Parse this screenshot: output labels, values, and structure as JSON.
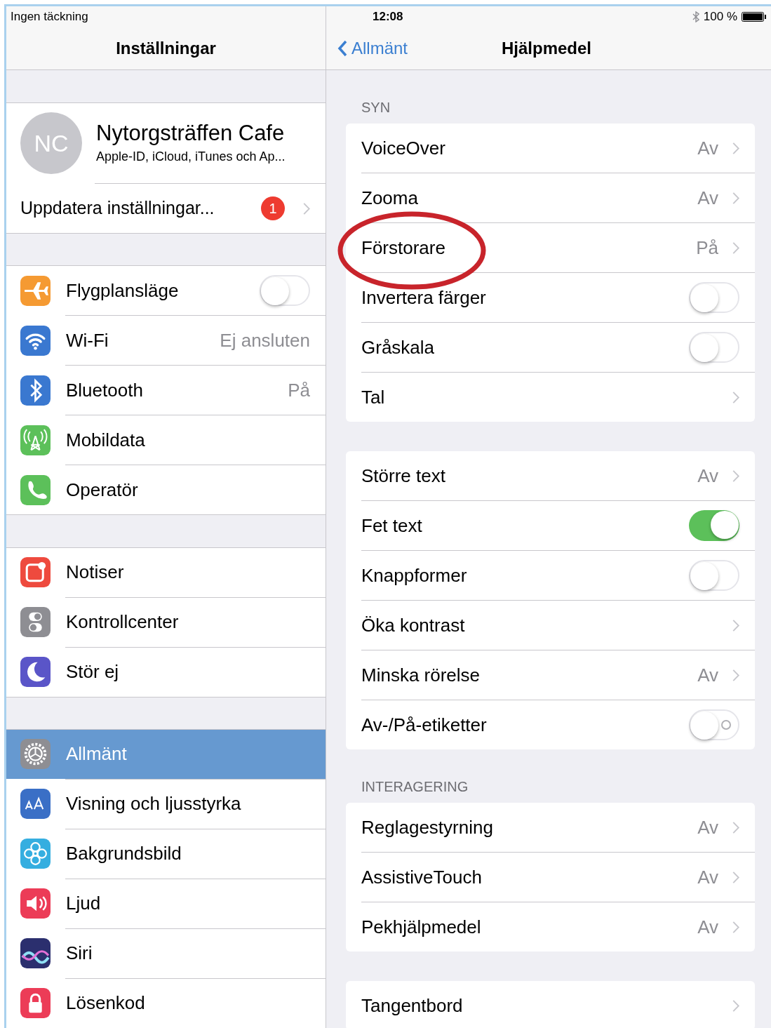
{
  "status_bar": {
    "carrier": "Ingen täckning",
    "time": "12:08",
    "battery": "100 %"
  },
  "sidebar": {
    "title": "Inställningar",
    "profile": {
      "initials": "NC",
      "name": "Nytorgsträffen Cafe",
      "subtitle": "Apple-ID, iCloud, iTunes och Ap..."
    },
    "update": {
      "label": "Uppdatera inställningar...",
      "badge": "1"
    },
    "groups": [
      [
        {
          "label": "Flygplansläge",
          "kind": "toggle",
          "on": false,
          "color": "#f59a32",
          "selected": false
        },
        {
          "label": "Wi-Fi",
          "kind": "value",
          "value": "Ej ansluten",
          "color": "#3a78d0",
          "selected": false
        },
        {
          "label": "Bluetooth",
          "kind": "value",
          "value": "På",
          "color": "#3a78d0",
          "selected": false
        },
        {
          "label": "Mobildata",
          "kind": "plain",
          "color": "#5cc05a",
          "selected": false
        },
        {
          "label": "Operatör",
          "kind": "plain",
          "color": "#5cc05a",
          "selected": false
        }
      ],
      [
        {
          "label": "Notiser",
          "kind": "plain",
          "color": "#ee4a3e",
          "selected": false
        },
        {
          "label": "Kontrollcenter",
          "kind": "plain",
          "color": "#8e8e93",
          "selected": false
        },
        {
          "label": "Stör ej",
          "kind": "plain",
          "color": "#5a55c8",
          "selected": false
        }
      ],
      [
        {
          "label": "Allmänt",
          "kind": "plain",
          "color": "#8e8e93",
          "selected": true
        },
        {
          "label": "Visning och ljusstyrka",
          "kind": "plain",
          "color": "#3a6fc6",
          "selected": false
        },
        {
          "label": "Bakgrundsbild",
          "kind": "plain",
          "color": "#35aee0",
          "selected": false
        },
        {
          "label": "Ljud",
          "kind": "plain",
          "color": "#ec3c57",
          "selected": false
        },
        {
          "label": "Siri",
          "kind": "plain",
          "color": "#2b2f6e",
          "selected": false
        },
        {
          "label": "Lösenkod",
          "kind": "plain",
          "color": "#ec3c57",
          "selected": false
        }
      ]
    ]
  },
  "detail": {
    "back": "Allmänt",
    "title": "Hjälpmedel",
    "sections": [
      {
        "header": "SYN",
        "rows": [
          {
            "label": "VoiceOver",
            "kind": "value",
            "value": "Av",
            "circled": false
          },
          {
            "label": "Zooma",
            "kind": "value",
            "value": "Av",
            "circled": false
          },
          {
            "label": "Förstorare",
            "kind": "value",
            "value": "På",
            "circled": true
          },
          {
            "label": "Invertera färger",
            "kind": "toggle",
            "on": false,
            "off_mark": false,
            "circled": false
          },
          {
            "label": "Gråskala",
            "kind": "toggle",
            "on": false,
            "off_mark": false,
            "circled": false
          },
          {
            "label": "Tal",
            "kind": "link",
            "circled": false
          }
        ]
      },
      {
        "rows": [
          {
            "label": "Större text",
            "kind": "value",
            "value": "Av",
            "circled": false
          },
          {
            "label": "Fet text",
            "kind": "toggle",
            "on": true,
            "off_mark": false,
            "circled": false
          },
          {
            "label": "Knappformer",
            "kind": "toggle",
            "on": false,
            "off_mark": false,
            "circled": false
          },
          {
            "label": "Öka kontrast",
            "kind": "link",
            "circled": false
          },
          {
            "label": "Minska rörelse",
            "kind": "value",
            "value": "Av",
            "circled": false
          },
          {
            "label": "Av-/På-etiketter",
            "kind": "toggle",
            "on": false,
            "off_mark": true,
            "circled": false
          }
        ]
      },
      {
        "header": "INTERAGERING",
        "rows": [
          {
            "label": "Reglagestyrning",
            "kind": "value",
            "value": "Av",
            "circled": false
          },
          {
            "label": "AssistiveTouch",
            "kind": "value",
            "value": "Av",
            "circled": false
          },
          {
            "label": "Pekhjälpmedel",
            "kind": "value",
            "value": "Av",
            "circled": false
          }
        ]
      },
      {
        "rows": [
          {
            "label": "Tangentbord",
            "kind": "link",
            "circled": false
          }
        ]
      }
    ]
  }
}
